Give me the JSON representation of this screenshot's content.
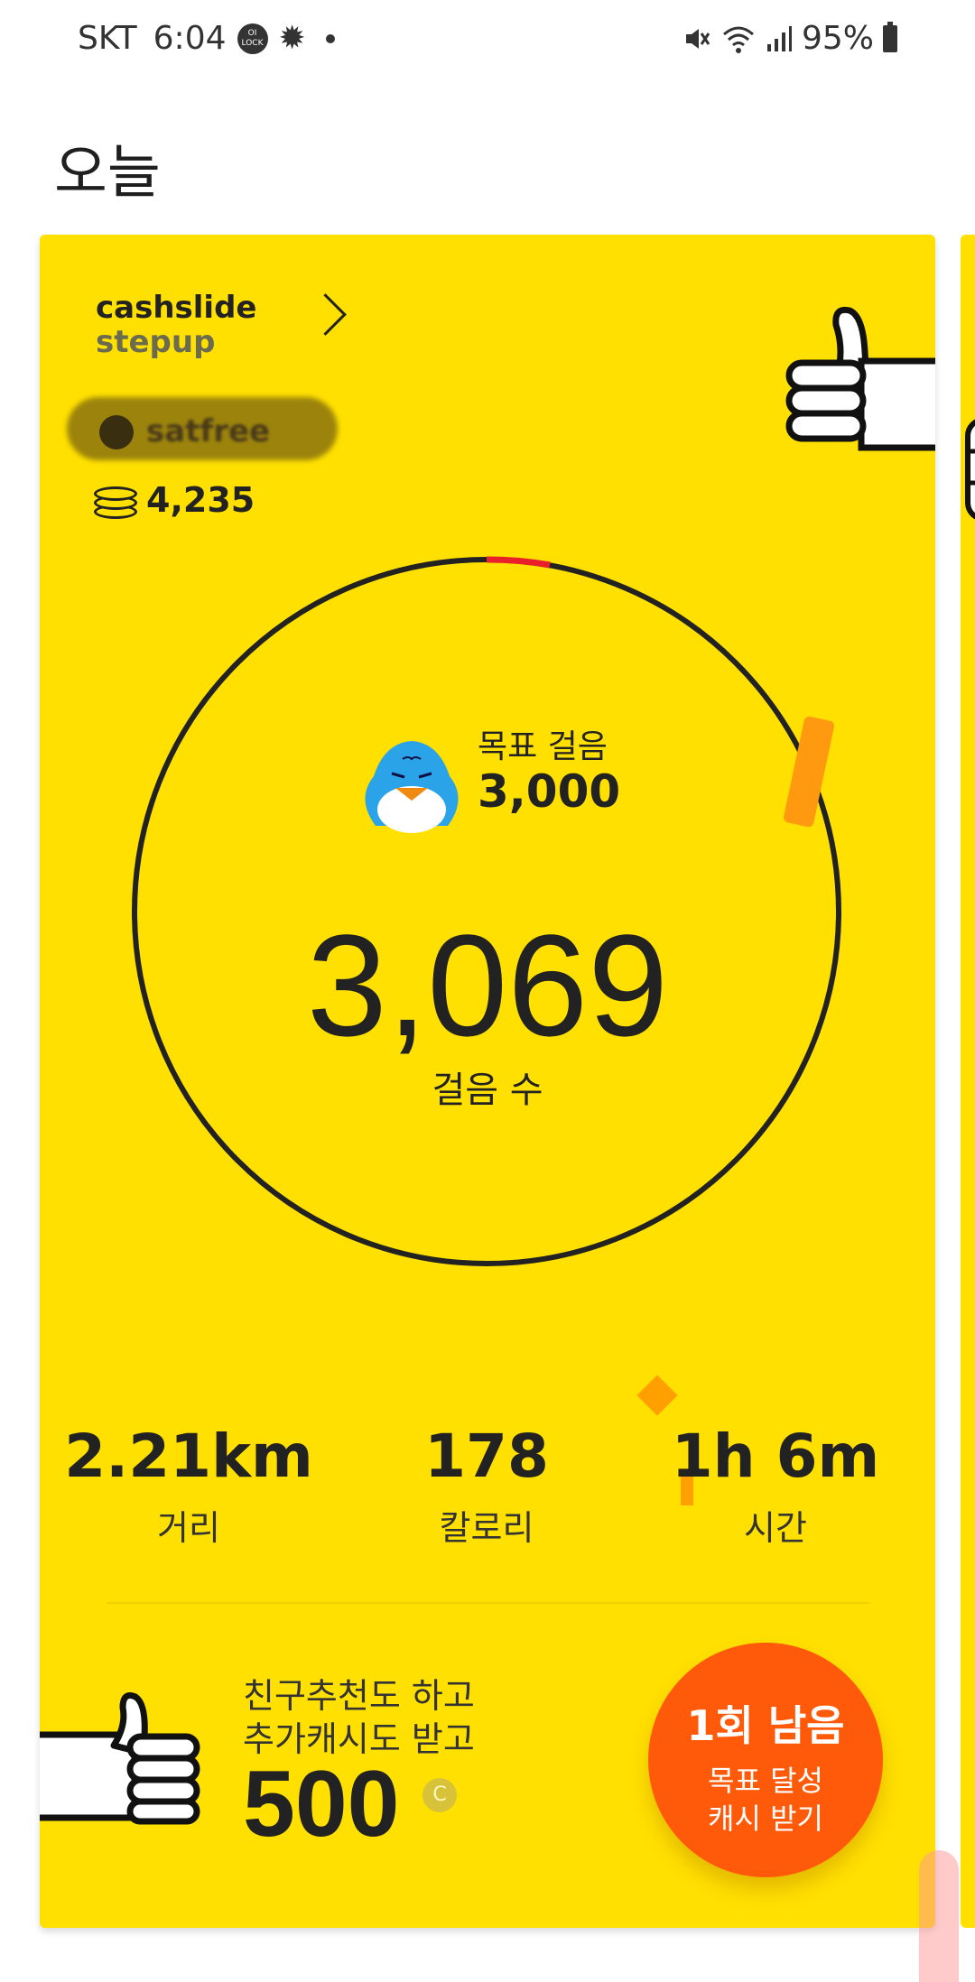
{
  "status_bar": {
    "carrier": "SKT",
    "time": "6:04",
    "battery": "95%",
    "icons": [
      "lock-icon",
      "gear-icon",
      "dot-icon",
      "mute-icon",
      "wifi-icon",
      "signal-icon",
      "battery-icon"
    ]
  },
  "page": {
    "title": "오늘"
  },
  "card": {
    "brand_line1": "cashslide",
    "brand_line2": "stepup",
    "user_name": "satfree",
    "coins": "4,235",
    "goal_label": "목표 걸음",
    "goal_value": "3,000",
    "steps": "3,069",
    "steps_label": "걸음 수",
    "progress_fraction": 1.0,
    "stats": [
      {
        "value": "2.21km",
        "label": "거리"
      },
      {
        "value": "178",
        "label": "칼로리"
      },
      {
        "value": "1h 6m",
        "label": "시간"
      }
    ],
    "promo_line1": "친구추천도 하고",
    "promo_line2": "추가캐시도 받고",
    "promo_value": "500",
    "promo_currency": "C",
    "cta_line1": "1회 남음",
    "cta_line2": "목표 달성",
    "cta_line3": "캐시 받기"
  },
  "colors": {
    "card": "#ffe000",
    "cta": "#ff5a0a",
    "ring": "#222222",
    "ring_accent": "#e8202a"
  }
}
